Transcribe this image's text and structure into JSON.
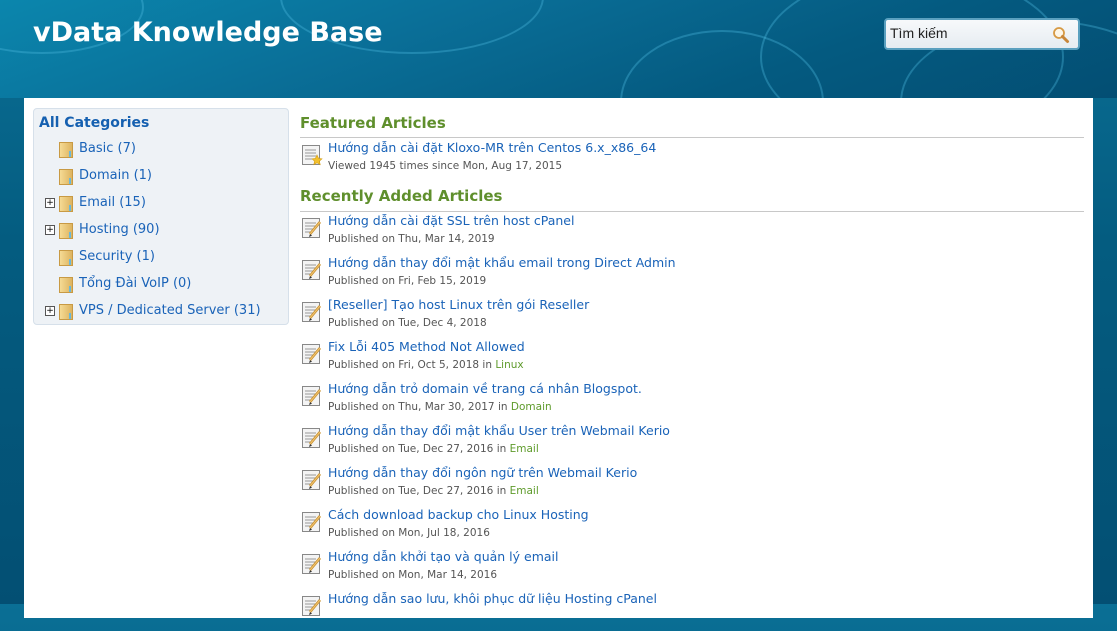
{
  "header": {
    "title": "vData Knowledge Base",
    "search": {
      "value": "Tìm kiếm",
      "icon": "search-icon"
    }
  },
  "sidebar": {
    "title": "All Categories",
    "items": [
      {
        "label": "Basic (7)",
        "expandable": false,
        "icon": "folder-icon"
      },
      {
        "label": "Domain (1)",
        "expandable": false,
        "icon": "folder-icon"
      },
      {
        "label": "Email (15)",
        "expandable": true,
        "icon": "folder-icon"
      },
      {
        "label": "Hosting (90)",
        "expandable": true,
        "icon": "folder-icon"
      },
      {
        "label": "Security (1)",
        "expandable": false,
        "icon": "folder-icon"
      },
      {
        "label": "Tổng Đài VoIP (0)",
        "expandable": false,
        "icon": "folder-icon"
      },
      {
        "label": "VPS / Dedicated Server (31)",
        "expandable": true,
        "icon": "folder-icon"
      }
    ]
  },
  "featured": {
    "title": "Featured Articles",
    "articles": [
      {
        "title": "Hướng dẫn cài đặt Kloxo-MR trên Centos 6.x_x86_64",
        "meta": "Viewed 1945 times since Mon, Aug 17, 2015",
        "category": ""
      }
    ]
  },
  "recent": {
    "title": "Recently Added Articles",
    "in_label": "in",
    "articles": [
      {
        "title": "Hướng dẫn cài đặt SSL trên host cPanel",
        "meta": "Published on Thu, Mar 14, 2019",
        "category": ""
      },
      {
        "title": "Hướng dẫn thay đổi mật khẩu email trong Direct Admin",
        "meta": "Published on Fri, Feb 15, 2019",
        "category": ""
      },
      {
        "title": "[Reseller] Tạo host Linux trên gói Reseller",
        "meta": "Published on Tue, Dec 4, 2018",
        "category": ""
      },
      {
        "title": "Fix Lỗi 405 Method Not Allowed",
        "meta": "Published on Fri, Oct 5, 2018",
        "category": "Linux"
      },
      {
        "title": "Hướng dẫn trỏ domain về trang cá nhân Blogspot.",
        "meta": "Published on Thu, Mar 30, 2017",
        "category": "Domain"
      },
      {
        "title": "Hướng dẫn thay đổi mật khẩu User trên Webmail Kerio",
        "meta": "Published on Tue, Dec 27, 2016",
        "category": "Email"
      },
      {
        "title": "Hướng dẫn thay đổi ngôn ngữ trên Webmail Kerio",
        "meta": "Published on Tue, Dec 27, 2016",
        "category": "Email"
      },
      {
        "title": "Cách download backup cho Linux Hosting",
        "meta": "Published on Mon, Jul 18, 2016",
        "category": ""
      },
      {
        "title": "Hướng dẫn khởi tạo và quản lý email",
        "meta": "Published on Mon, Mar 14, 2016",
        "category": ""
      },
      {
        "title": "Hướng dẫn sao lưu, khôi phục dữ liệu Hosting cPanel",
        "meta": "",
        "category": ""
      }
    ]
  },
  "colors": {
    "link": "#1a63b8",
    "section_title": "#5f8f2c",
    "category_link": "#5f9b2c",
    "header_bg": "#045c80"
  }
}
